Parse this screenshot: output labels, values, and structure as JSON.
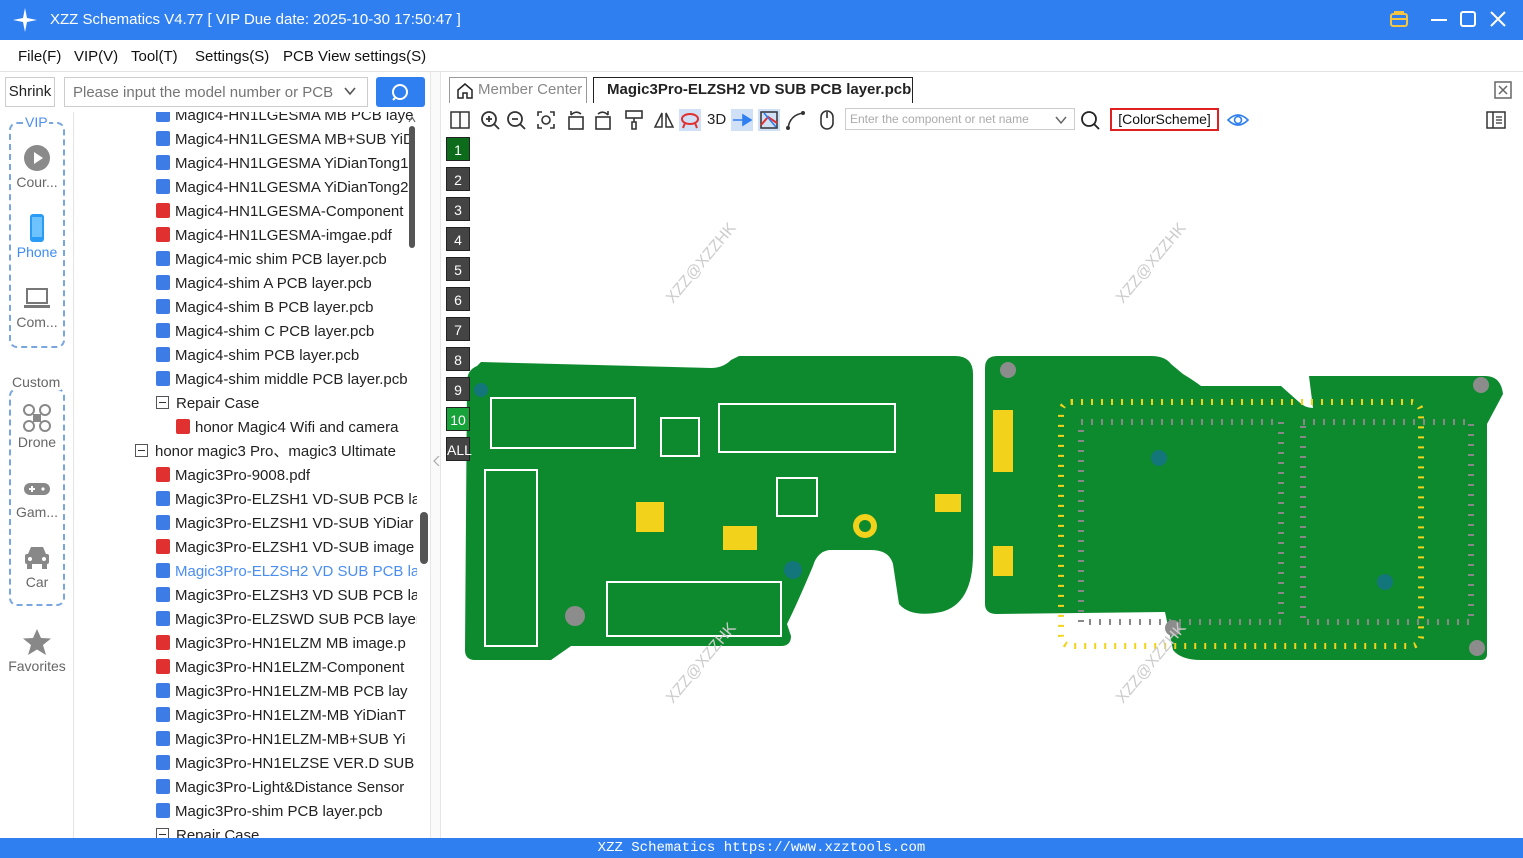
{
  "titlebar": {
    "title": "XZZ Schematics V4.77 [ VIP Due date: 2025-10-30 17:50:47 ]"
  },
  "menu": {
    "items": [
      "File(F)",
      "VIP(V)",
      "Tool(T)",
      "Settings(S)",
      "PCB View settings(S)"
    ]
  },
  "left": {
    "shrink_label": "Shrink",
    "search_placeholder": "Please input the model number or PCB"
  },
  "nav": {
    "vip_label": "VIP",
    "custom_label": "Custom",
    "items": [
      {
        "label": "Cour...",
        "icon": "play-icon"
      },
      {
        "label": "Phone",
        "icon": "phone-icon"
      },
      {
        "label": "Com...",
        "icon": "laptop-icon"
      },
      {
        "label": "Drone",
        "icon": "drone-icon"
      },
      {
        "label": "Gam...",
        "icon": "gamepad-icon"
      },
      {
        "label": "Car",
        "icon": "car-icon"
      },
      {
        "label": "Favorites",
        "icon": "star-icon"
      }
    ]
  },
  "tree": {
    "items": [
      {
        "label": "Magic4-HN1LGESMA MB PCB laye",
        "type": "pcb"
      },
      {
        "label": "Magic4-HN1LGESMA MB+SUB YiD",
        "type": "pcb"
      },
      {
        "label": "Magic4-HN1LGESMA YiDianTong1",
        "type": "pcb"
      },
      {
        "label": "Magic4-HN1LGESMA YiDianTong2",
        "type": "pcb"
      },
      {
        "label": "Magic4-HN1LGESMA-Component",
        "type": "pdf"
      },
      {
        "label": "Magic4-HN1LGESMA-imgae.pdf",
        "type": "pdf"
      },
      {
        "label": "Magic4-mic shim PCB layer.pcb",
        "type": "pcb"
      },
      {
        "label": "Magic4-shim A PCB layer.pcb",
        "type": "pcb"
      },
      {
        "label": "Magic4-shim B PCB layer.pcb",
        "type": "pcb"
      },
      {
        "label": "Magic4-shim C PCB layer.pcb",
        "type": "pcb"
      },
      {
        "label": "Magic4-shim PCB layer.pcb",
        "type": "pcb"
      },
      {
        "label": "Magic4-shim middle PCB layer.pcb",
        "type": "pcb"
      },
      {
        "label": "Repair Case",
        "type": "folder"
      },
      {
        "label": "honor Magic4 Wifi and camera",
        "type": "pdf",
        "indent": 2
      },
      {
        "label": "honor magic3 Pro、magic3 Ultimate",
        "type": "folder",
        "indent": -1
      },
      {
        "label": "Magic3Pro-9008.pdf",
        "type": "pdf"
      },
      {
        "label": "Magic3Pro-ELZSH1 VD-SUB PCB la",
        "type": "pcb"
      },
      {
        "label": "Magic3Pro-ELZSH1 VD-SUB YiDiar",
        "type": "pcb"
      },
      {
        "label": "Magic3Pro-ELZSH1 VD-SUB image",
        "type": "pdf"
      },
      {
        "label": "Magic3Pro-ELZSH2 VD SUB PCB la",
        "type": "pcb",
        "selected": true
      },
      {
        "label": "Magic3Pro-ELZSH3 VD SUB PCB la",
        "type": "pcb"
      },
      {
        "label": "Magic3Pro-ELZSWD SUB PCB layer",
        "type": "pcb"
      },
      {
        "label": "Magic3Pro-HN1ELZM MB image.p",
        "type": "pdf"
      },
      {
        "label": "Magic3Pro-HN1ELZM-Component",
        "type": "pdf"
      },
      {
        "label": "Magic3Pro-HN1ELZM-MB PCB lay",
        "type": "pcb"
      },
      {
        "label": "Magic3Pro-HN1ELZM-MB YiDianT",
        "type": "pcb"
      },
      {
        "label": "Magic3Pro-HN1ELZM-MB+SUB Yi",
        "type": "pcb"
      },
      {
        "label": "Magic3Pro-HN1ELZSE VER.D SUB I",
        "type": "pcb"
      },
      {
        "label": "Magic3Pro-Light&Distance Sensor",
        "type": "pcb"
      },
      {
        "label": "Magic3Pro-shim PCB layer.pcb",
        "type": "pcb"
      },
      {
        "label": "Repair Case",
        "type": "folder"
      }
    ]
  },
  "tabs": {
    "member_center": "Member Center",
    "active": "Magic3Pro-ELZSH2 VD SUB PCB layer.pcb"
  },
  "toolbar": {
    "three_d": "3D",
    "component_placeholder": "Enter the component or net name",
    "color_scheme": "[ColorScheme]"
  },
  "layers": [
    "1",
    "2",
    "3",
    "4",
    "5",
    "6",
    "7",
    "8",
    "9",
    "10",
    "ALL"
  ],
  "watermark": "XZZ@XZZHK",
  "status": {
    "text": "XZZ Schematics https://www.xzztools.com"
  },
  "colors": {
    "accent": "#2f7ff0",
    "pcb_green": "#0e8a2e",
    "pad_yellow": "#f2d21a",
    "via_gray": "#8c8c8c"
  }
}
